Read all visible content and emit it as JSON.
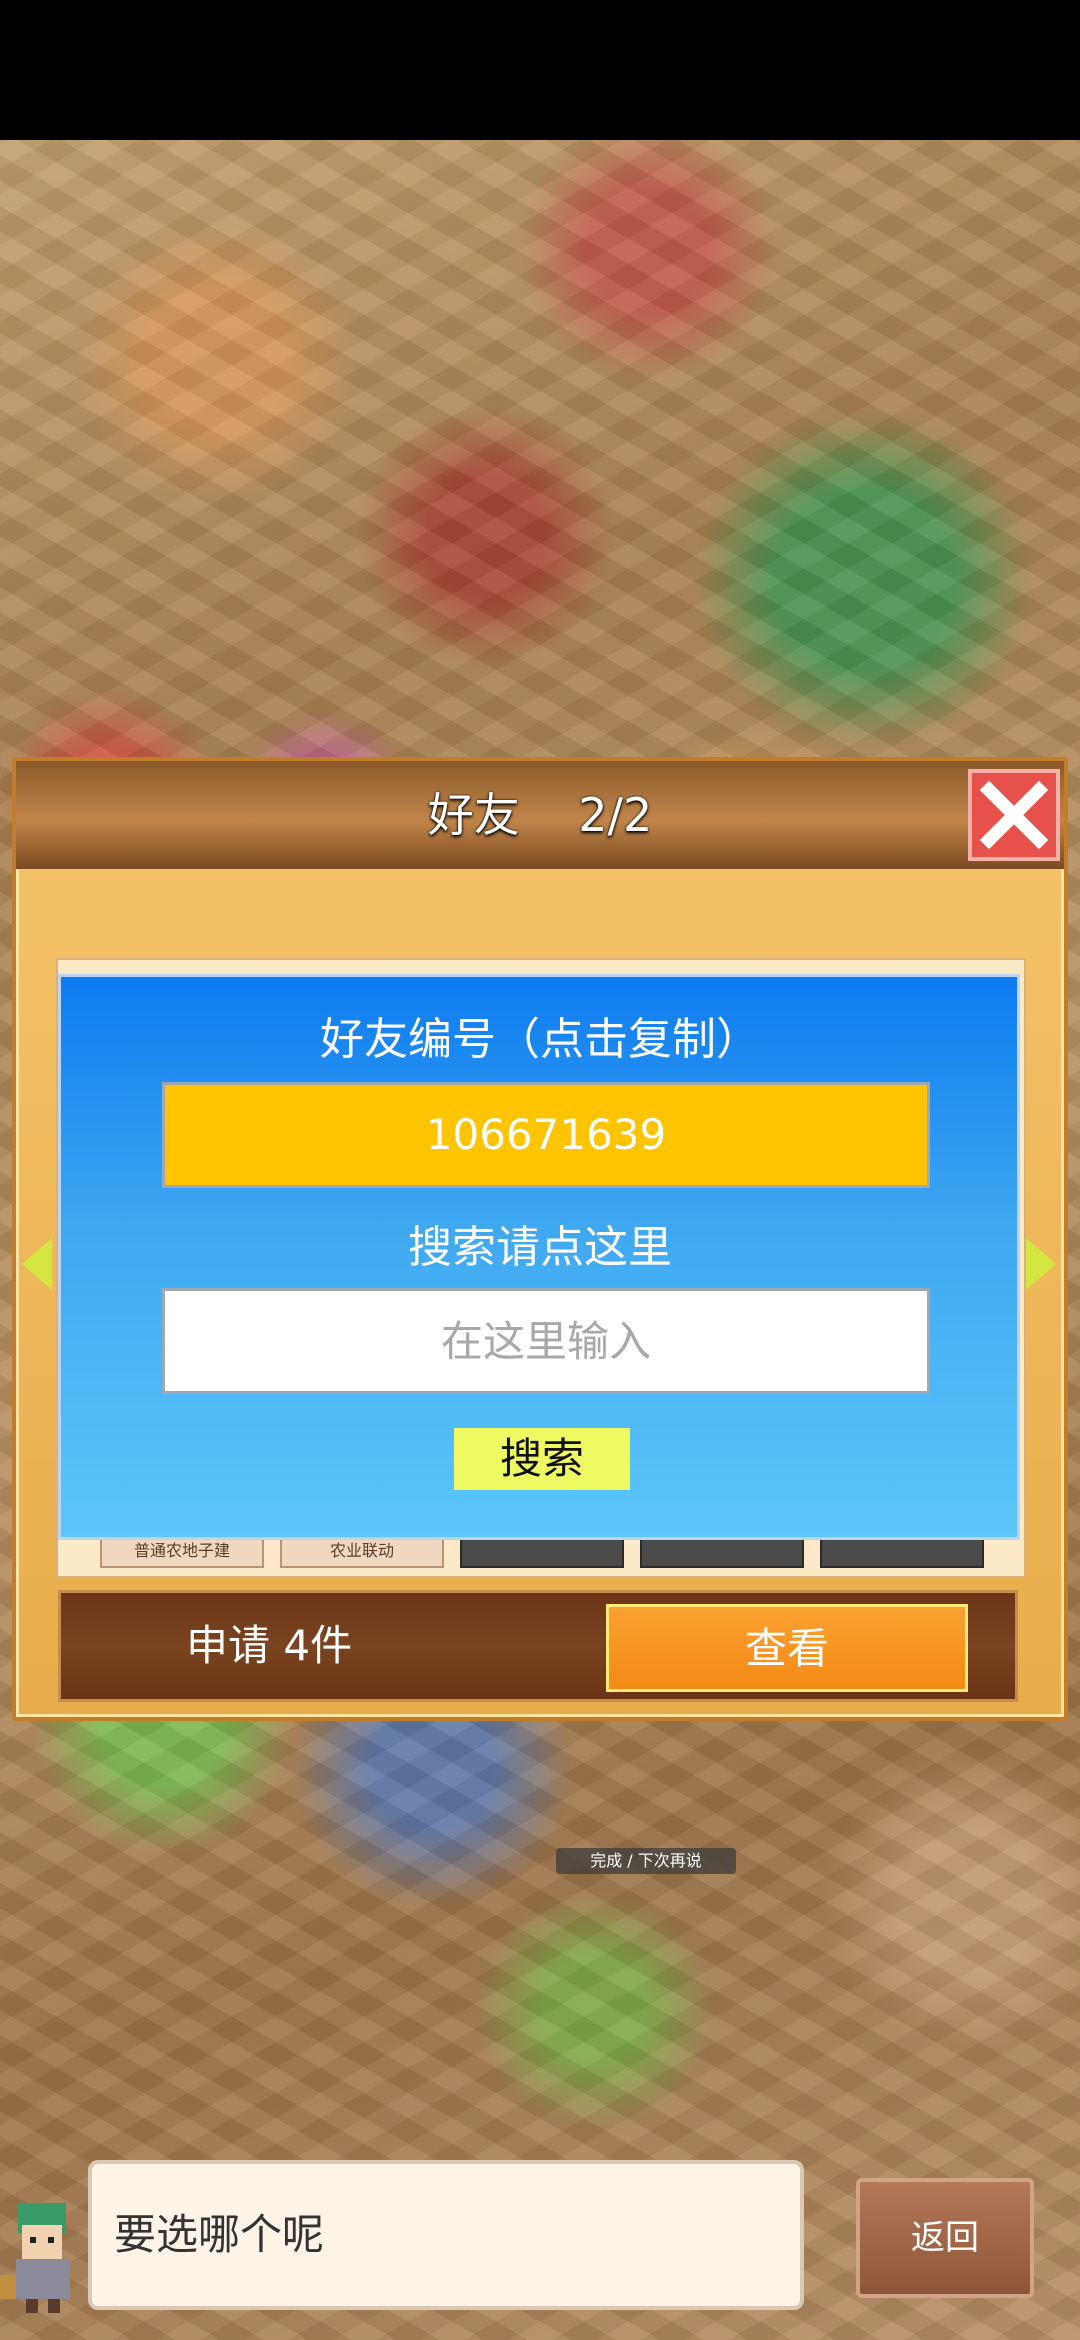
{
  "panel": {
    "title": "好友",
    "page_indicator": "2/2",
    "close_icon": "close-icon"
  },
  "background_hint": "完成 / 下次再说",
  "cards_bottom": [
    "普通农地子建",
    "农业联动"
  ],
  "search_dialog": {
    "friend_id_label": "好友编号（点击复制）",
    "friend_id": "106671639",
    "search_label": "搜索请点这里",
    "search_placeholder": "在这里输入",
    "search_button": "搜索"
  },
  "requests": {
    "count_label": "申请 4件",
    "view_button": "查看"
  },
  "footer": {
    "speech_text": "要选哪个呢",
    "back_button": "返回"
  },
  "colors": {
    "dialog_blue": "#0d7bf0",
    "id_yellow": "#fec402",
    "view_orange": "#f38a16",
    "close_red": "#e6524b"
  }
}
